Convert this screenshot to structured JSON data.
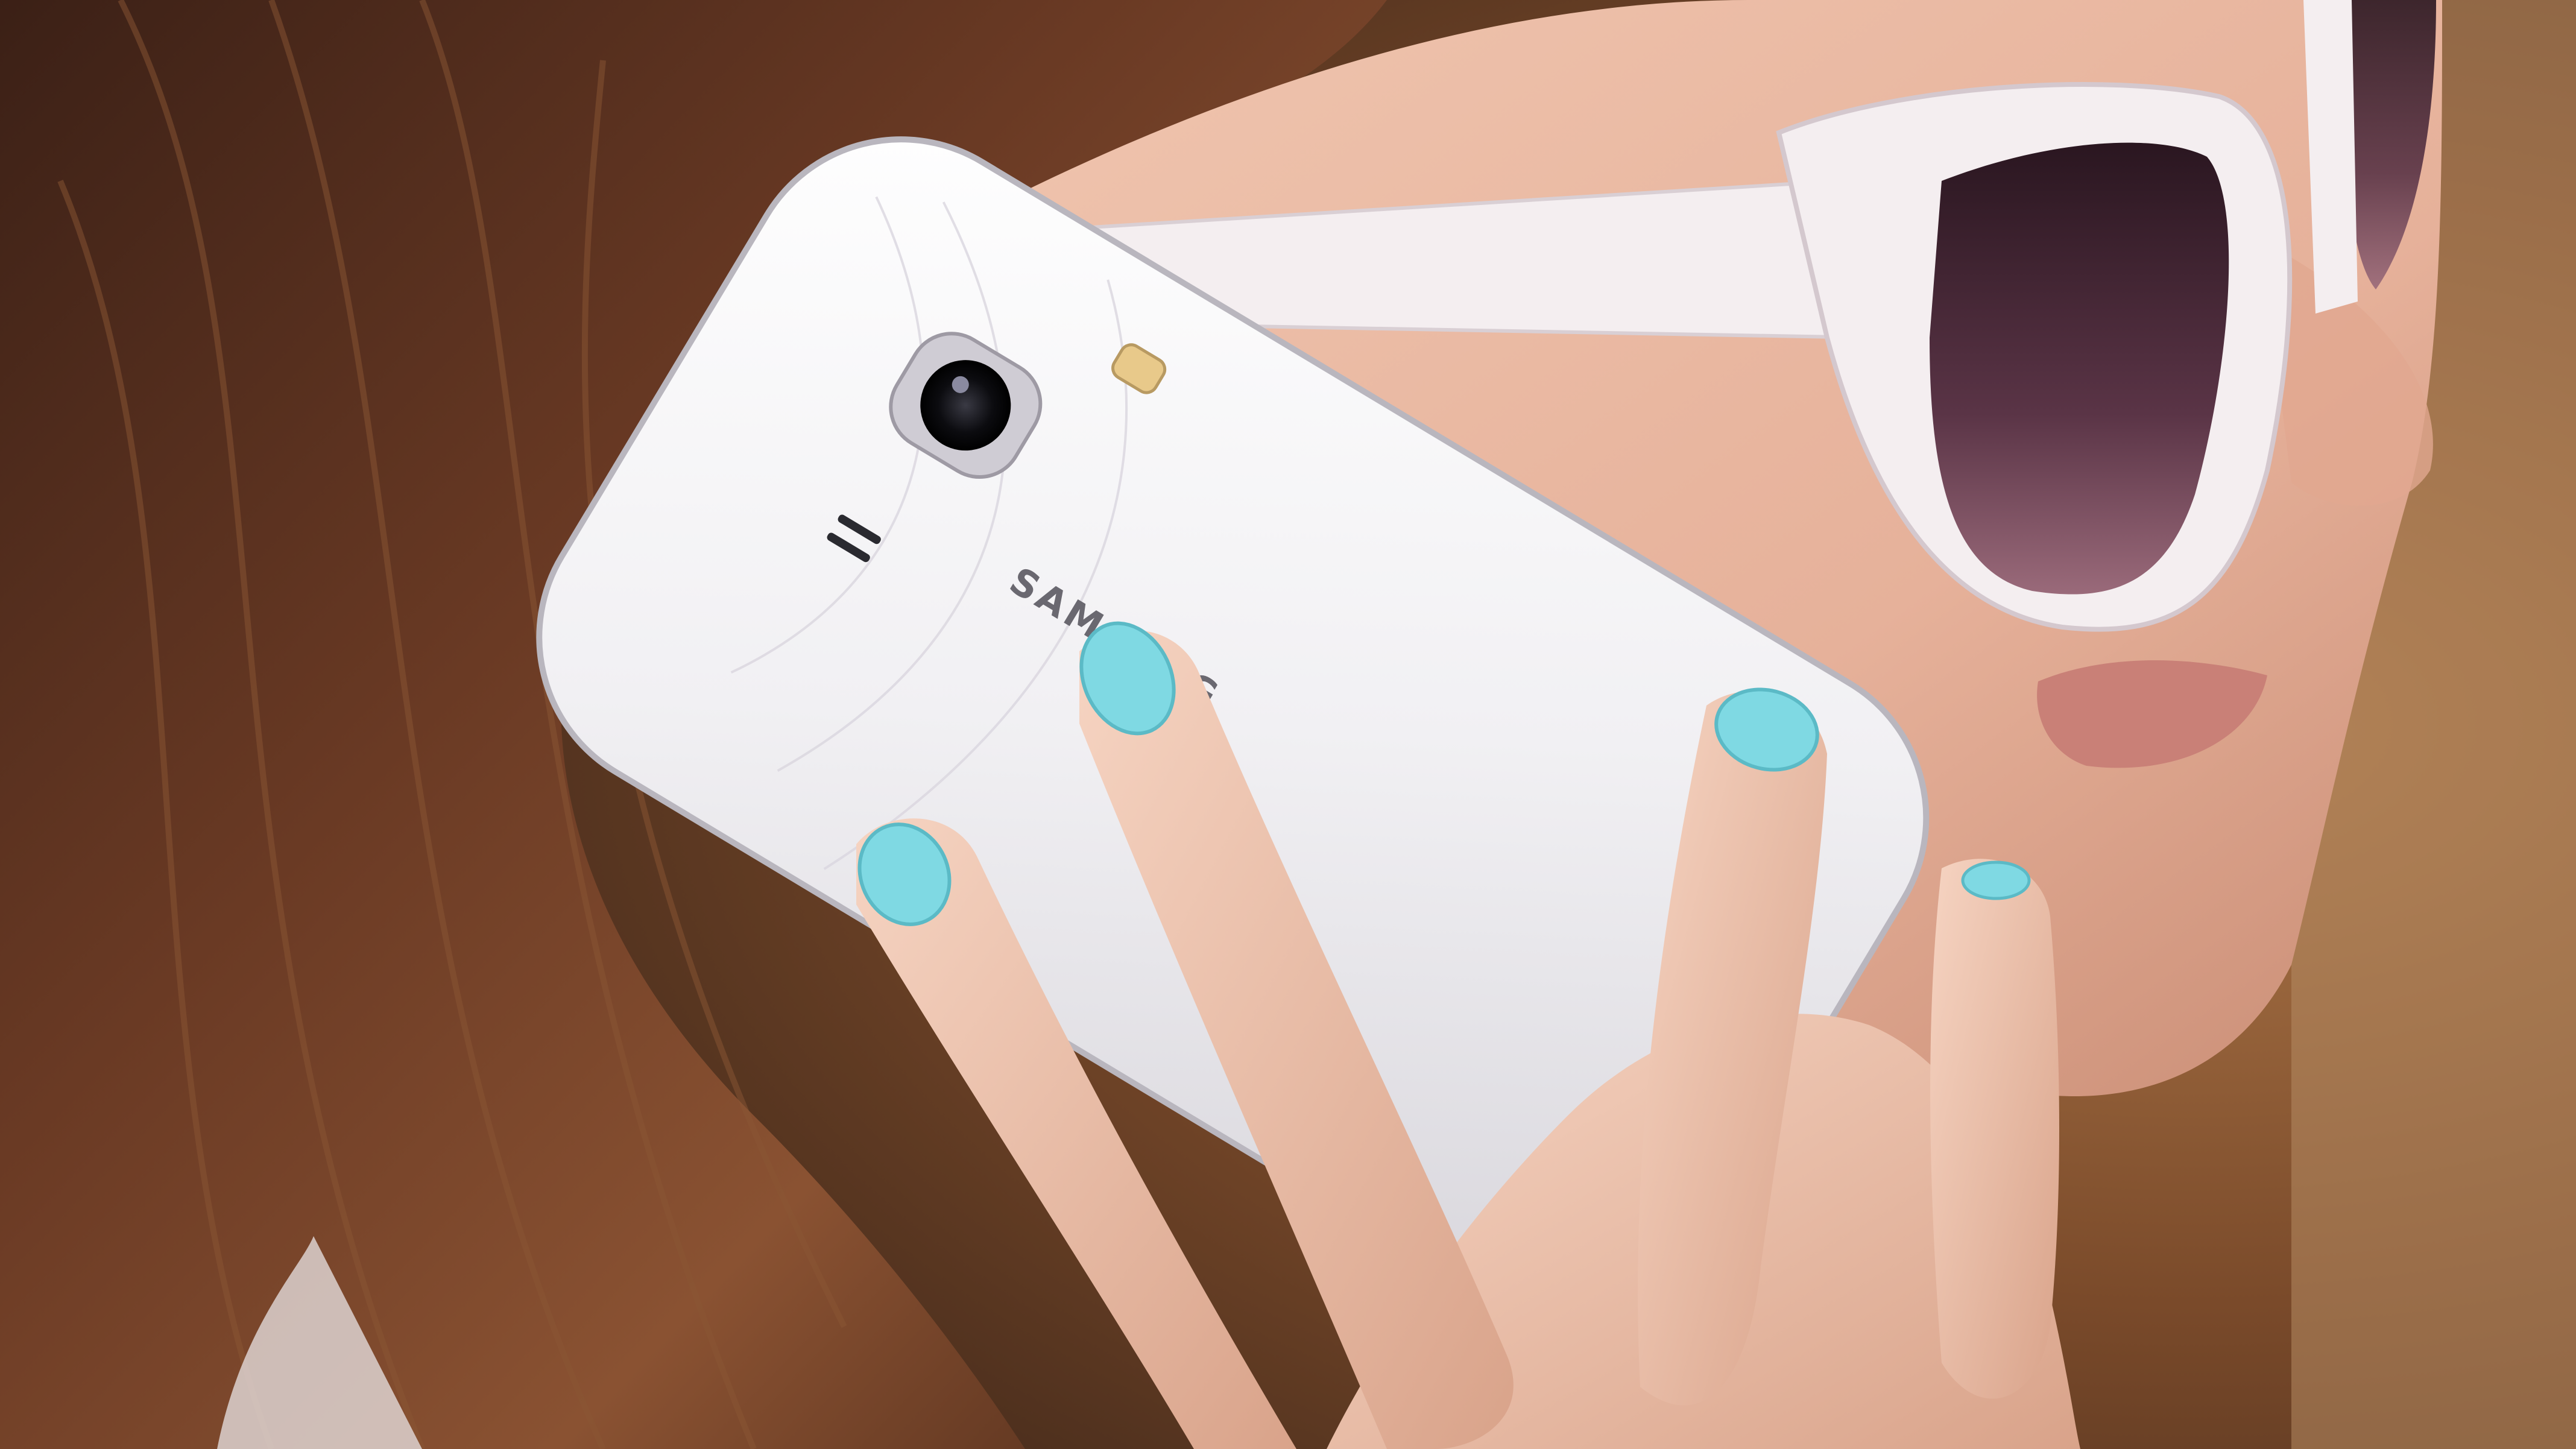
{
  "photo": {
    "phone_brand_text": "SAMSUNG"
  },
  "colors": {
    "background": "#7a4a2a",
    "hair": "#5a3220",
    "skin": "#e9b9a3",
    "phone": "#f2f1f3",
    "sunglasses_frame": "#f4eef0",
    "lens": "#4a2a38",
    "nail_polish": "#7fd9e3"
  }
}
